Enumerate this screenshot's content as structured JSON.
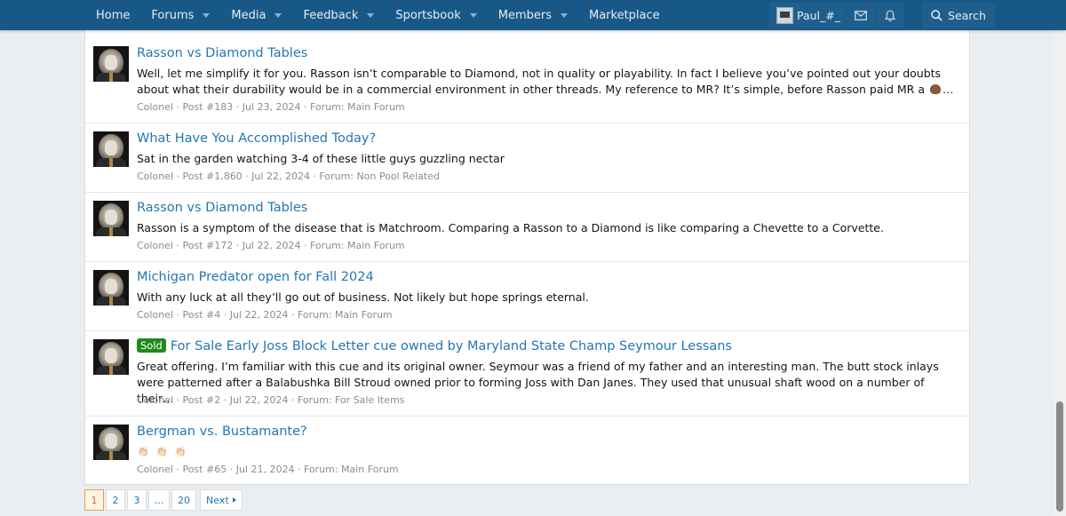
{
  "nav": {
    "items": [
      {
        "label": "Home",
        "dropdown": false
      },
      {
        "label": "Forums",
        "dropdown": true
      },
      {
        "label": "Media",
        "dropdown": true
      },
      {
        "label": "Feedback",
        "dropdown": true
      },
      {
        "label": "Sportsbook",
        "dropdown": true
      },
      {
        "label": "Members",
        "dropdown": true
      },
      {
        "label": "Marketplace",
        "dropdown": false
      }
    ],
    "account": {
      "username": "Paul_#_"
    },
    "icons": [
      "mail-icon",
      "bell-icon"
    ],
    "search_label": "Search"
  },
  "colors": {
    "nav_bg": "#185886",
    "link": "#2577b1",
    "sold_badge": "#1f8a1f"
  },
  "results": [
    {
      "title": "Rasson vs Diamond Tables",
      "badge": "",
      "snippet": "Well, let me simplify it for you. Rasson isn’t comparable to Diamond, not in quality or playability. In fact I believe you’ve pointed out your doubts about what their durability would be in a commercial environment in other threads. My reference to MR? It’s simple, before Rasson paid MR a",
      "snippet_tail": "…",
      "emoji": "poop",
      "meta": "Colonel · Post #183 · Jul 23, 2024 · Forum: Main Forum"
    },
    {
      "title": "What Have You Accomplished Today?",
      "badge": "",
      "snippet": "Sat in the garden watching 3-4 of these little guys guzzling nectar",
      "meta": "Colonel · Post #1,860 · Jul 22, 2024 · Forum: Non Pool Related"
    },
    {
      "title": "Rasson vs Diamond Tables",
      "badge": "",
      "snippet": "Rasson is a symptom of the disease that is Matchroom. Comparing a Rasson to a Diamond is like comparing a Chevette to a Corvette.",
      "meta": "Colonel · Post #172 · Jul 22, 2024 · Forum: Main Forum"
    },
    {
      "title": "Michigan Predator open for Fall 2024",
      "badge": "",
      "snippet": "With any luck at all they’ll go out of business. Not likely but hope springs eternal.",
      "meta": "Colonel · Post #4 · Jul 22, 2024 · Forum: Main Forum"
    },
    {
      "title": "For Sale Early Joss Block Letter cue owned by Maryland State Champ Seymour Lessans",
      "badge": "Sold",
      "snippet": "Great offering. I’m familiar with this cue and its original owner. Seymour was a friend of my father and an interesting man. The butt stock inlays were patterned after a Balabushka Bill Stroud owned prior to forming Joss with Dan Janes. They used that unusual shaft wood on a number of their…",
      "meta": "Colonel · Post #2 · Jul 22, 2024 · Forum: For Sale Items"
    },
    {
      "title": "Bergman vs. Bustamante?",
      "badge": "",
      "snippet": "👏🏻 👏🏻 👏🏻",
      "meta": "Colonel · Post #65 · Jul 21, 2024 · Forum: Main Forum"
    }
  ],
  "pagination": {
    "pages": [
      "1",
      "2",
      "3",
      "…",
      "20"
    ],
    "current": "1",
    "next_label": "Next"
  }
}
